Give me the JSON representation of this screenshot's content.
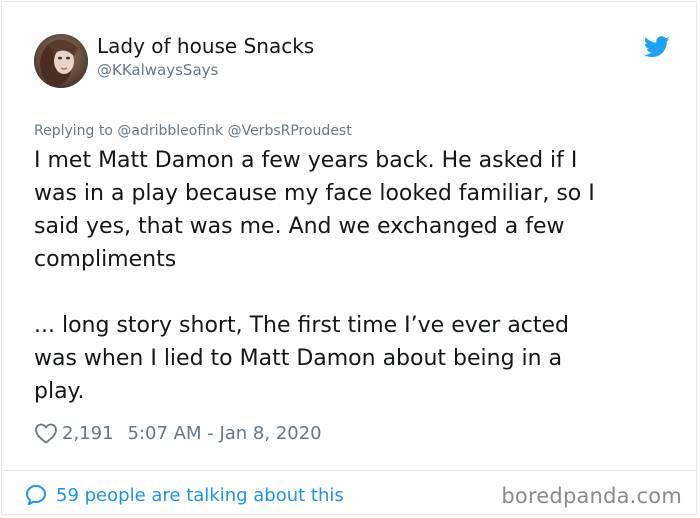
{
  "user": {
    "display_name": "Lady of house Snacks",
    "handle": "@KKalwaysSays",
    "avatar": "profile-photo"
  },
  "reply_context": "Replying to @adribbleofink @VerbsRProudest",
  "tweet": {
    "paragraphs": [
      "I met Matt Damon a few years back. He asked if I\nwas in a play because my face looked familiar, so I\nsaid yes, that was me. And we exchanged a few\ncompliments",
      "... long story short, The first time I’ve ever acted\nwas when I lied to Matt Damon about being in a\nplay."
    ]
  },
  "meta": {
    "likes": "2,191",
    "timestamp": "5:07 AM - Jan 8, 2020"
  },
  "footer": {
    "conversation_text": "59 people are talking about this"
  },
  "watermark": "boredpanda.com",
  "icons": {
    "brand": "twitter-bird-icon",
    "like": "heart-icon",
    "reply": "speech-bubble-icon"
  },
  "colors": {
    "twitter_blue": "#1da1f2",
    "link_blue": "#1b95e0",
    "secondary_text": "#657786",
    "primary_text": "#14171a",
    "border": "#e1e8ed"
  }
}
